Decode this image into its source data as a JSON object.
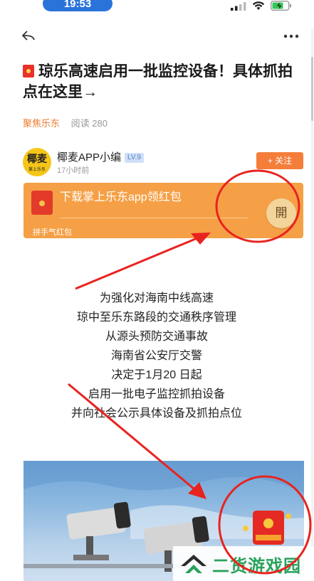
{
  "status": {
    "time": "19:53"
  },
  "article": {
    "title": "琼乐高速启用一批监控设备！具体抓拍点在这里→",
    "channel": "聚焦乐东",
    "read_count": "阅读 280"
  },
  "author": {
    "avatar_text": "椰麦",
    "avatar_subtext": "掌上乐东",
    "name": "椰麦APP小编",
    "level": "LV.9",
    "time": "17小时前",
    "follow_label": "+ 关注"
  },
  "red_packet": {
    "text": "下载掌上乐东app领红包",
    "sub": "拼手气红包",
    "open_label": "開"
  },
  "body_lines": [
    "为强化对海南中线高速",
    "琼中至乐东路段的交通秩序管理",
    "从源头预防交通事故",
    "海南省公安厅交警",
    "决定于1月20 日起",
    "启用一批电子监控抓拍设备",
    "并向社会公示具体设备及抓拍点位"
  ],
  "watermark": {
    "text": "二货游戏园"
  },
  "colors": {
    "accent_orange": "#f47d3a",
    "packet_bg": "#f5a046",
    "annotation_red": "#e8231f",
    "time_pill": "#2a73d9",
    "watermark_green": "#2aa25c"
  }
}
